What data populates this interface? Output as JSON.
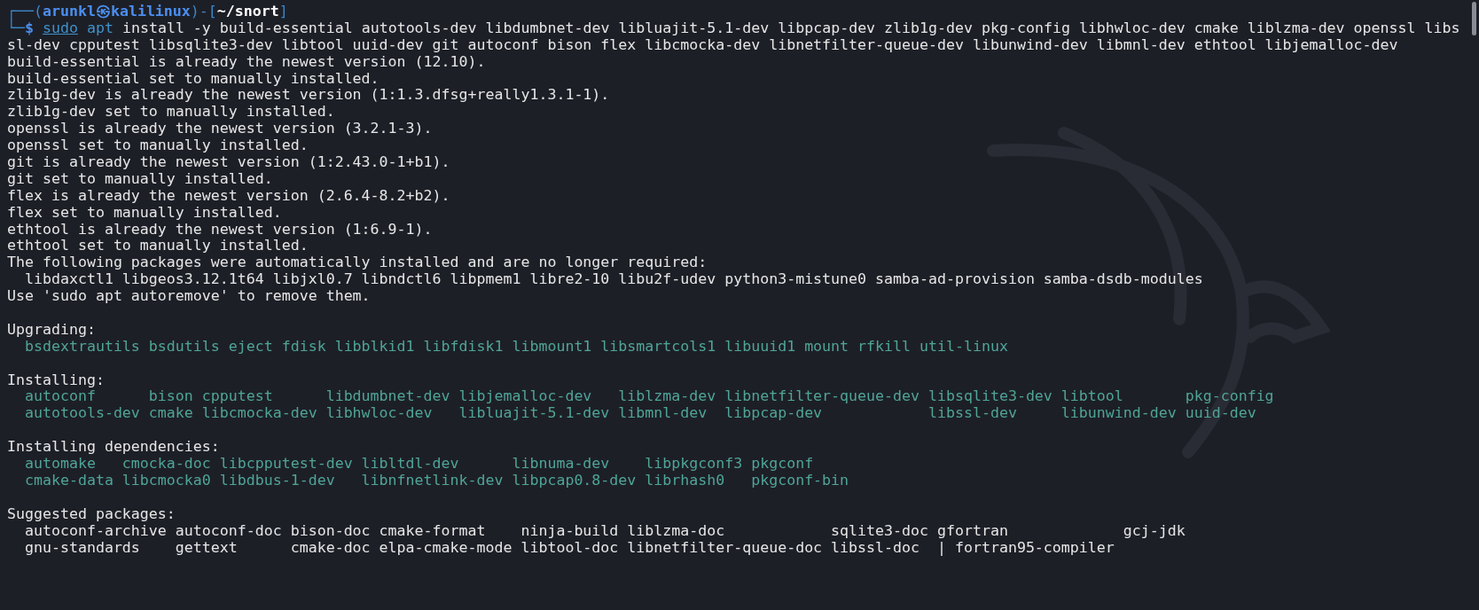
{
  "prompt": {
    "corner_top": "┌──(",
    "user": "arunkl",
    "at": "㉿",
    "host": "kalilinux",
    "separator": ")-[",
    "path": "~/snort",
    "close": "]",
    "corner_bottom": "└─",
    "symbol": "$"
  },
  "command": {
    "program": "sudo",
    "tool": "apt",
    "lines": [
      "install -y build-essential autotools-dev libdumbnet-dev libluajit-5.1-dev libpcap-dev zlib1g-dev pkg-config libhwloc-dev cmake liblzma-dev openssl libs",
      "sl-dev cpputest libsqlite3-dev libtool uuid-dev git autoconf bison flex libcmocka-dev libnetfilter-queue-dev libunwind-dev libmnl-dev ethtool libjemalloc-dev"
    ]
  },
  "output": [
    {
      "kind": "text",
      "text": "build-essential is already the newest version (12.10)."
    },
    {
      "kind": "text",
      "text": "build-essential set to manually installed."
    },
    {
      "kind": "text",
      "text": "zlib1g-dev is already the newest version (1:1.3.dfsg+really1.3.1-1)."
    },
    {
      "kind": "text",
      "text": "zlib1g-dev set to manually installed."
    },
    {
      "kind": "text",
      "text": "openssl is already the newest version (3.2.1-3)."
    },
    {
      "kind": "text",
      "text": "openssl set to manually installed."
    },
    {
      "kind": "text",
      "text": "git is already the newest version (1:2.43.0-1+b1)."
    },
    {
      "kind": "text",
      "text": "git set to manually installed."
    },
    {
      "kind": "text",
      "text": "flex is already the newest version (2.6.4-8.2+b2)."
    },
    {
      "kind": "text",
      "text": "flex set to manually installed."
    },
    {
      "kind": "text",
      "text": "ethtool is already the newest version (1:6.9-1)."
    },
    {
      "kind": "text",
      "text": "ethtool set to manually installed."
    },
    {
      "kind": "text",
      "text": "The following packages were automatically installed and are no longer required:"
    },
    {
      "kind": "text",
      "text": "  libdaxctl1 libgeos3.12.1t64 libjxl0.7 libndctl6 libpmem1 libre2-10 libu2f-udev python3-mistune0 samba-ad-provision samba-dsdb-modules"
    },
    {
      "kind": "text",
      "text": "Use 'sudo apt autoremove' to remove them."
    },
    {
      "kind": "blank"
    },
    {
      "kind": "text",
      "text": "Upgrading:"
    },
    {
      "kind": "packages",
      "text": "  bsdextrautils bsdutils eject fdisk libblkid1 libfdisk1 libmount1 libsmartcols1 libuuid1 mount rfkill util-linux"
    },
    {
      "kind": "blank"
    },
    {
      "kind": "text",
      "text": "Installing:"
    },
    {
      "kind": "packages",
      "text": "  autoconf      bison cpputest      libdumbnet-dev libjemalloc-dev   liblzma-dev libnetfilter-queue-dev libsqlite3-dev libtool       pkg-config"
    },
    {
      "kind": "packages",
      "text": "  autotools-dev cmake libcmocka-dev libhwloc-dev   libluajit-5.1-dev libmnl-dev  libpcap-dev            libssl-dev     libunwind-dev uuid-dev"
    },
    {
      "kind": "blank"
    },
    {
      "kind": "text",
      "text": "Installing dependencies:"
    },
    {
      "kind": "packages",
      "text": "  automake   cmocka-doc libcpputest-dev libltdl-dev      libnuma-dev    libpkgconf3 pkgconf"
    },
    {
      "kind": "packages",
      "text": "  cmake-data libcmocka0 libdbus-1-dev   libnfnetlink-dev libpcap0.8-dev librhash0   pkgconf-bin"
    },
    {
      "kind": "blank"
    },
    {
      "kind": "text",
      "text": "Suggested packages:"
    },
    {
      "kind": "text",
      "text": "  autoconf-archive autoconf-doc bison-doc cmake-format    ninja-build liblzma-doc            sqlite3-doc gfortran             gcj-jdk"
    },
    {
      "kind": "text",
      "text": "  gnu-standards    gettext      cmake-doc elpa-cmake-mode libtool-doc libnetfilter-queue-doc libssl-doc  | fortran95-compiler"
    }
  ]
}
